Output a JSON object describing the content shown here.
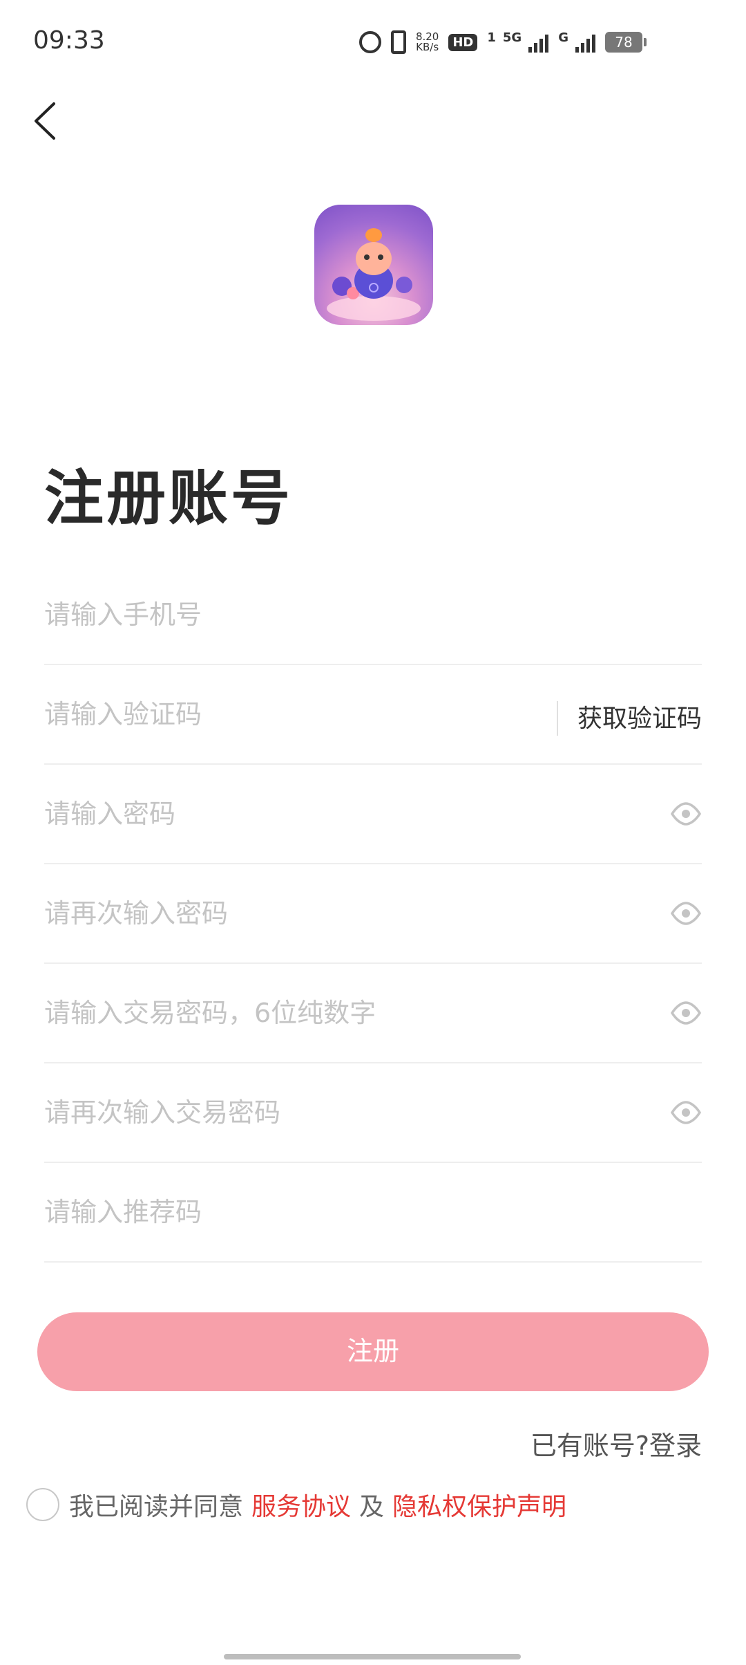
{
  "status_bar": {
    "time": "09:33",
    "speed_value": "8.20",
    "speed_unit": "KB/s",
    "hd_label": "HD",
    "hd_sub": "1",
    "net_5g": "5G",
    "net_g": "G",
    "battery": "78"
  },
  "page": {
    "title": "注册账号"
  },
  "fields": {
    "phone_placeholder": "请输入手机号",
    "code_placeholder": "请输入验证码",
    "get_code_label": "获取验证码",
    "password_placeholder": "请输入密码",
    "password_confirm_placeholder": "请再次输入密码",
    "trade_password_placeholder": "请输入交易密码，6位纯数字",
    "trade_password_confirm_placeholder": "请再次输入交易密码",
    "referral_placeholder": "请输入推荐码"
  },
  "actions": {
    "register_label": "注册",
    "login_link": "已有账号?登录"
  },
  "agreement": {
    "prefix": "我已阅读并同意",
    "service_link": "服务协议",
    "and": "及",
    "privacy_link": "隐私权保护声明"
  },
  "icons": {
    "back": "back-arrow-icon",
    "eye": "eye-icon",
    "alarm": "alarm-icon",
    "vibrate": "vibrate-icon"
  },
  "colors": {
    "accent_button": "#f7a0aa",
    "link_red": "#e53935",
    "placeholder": "#c4c4c4"
  }
}
